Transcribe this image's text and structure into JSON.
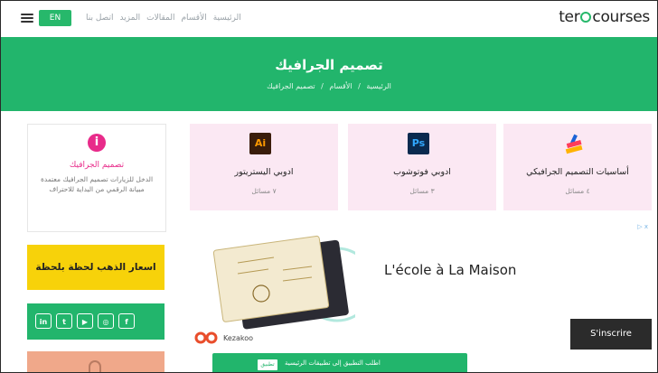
{
  "header": {
    "logo_text_left": "ter",
    "logo_text_right": "courses",
    "lang_button": "EN",
    "nav_items": [
      "الرئيسية",
      "الأقسام",
      "المقالات",
      "المزيد",
      "اتصل بنا"
    ]
  },
  "hero": {
    "title": "تصميم الجرافيك",
    "breadcrumb": [
      "الرئيسية",
      "الأقسام",
      "تصميم الجرافيك"
    ],
    "separator": "/"
  },
  "sidebar": {
    "category_icon": "info-icon",
    "category_icon_glyph": "i",
    "category_title": "تصميم الجرافيك",
    "category_desc": "الدخل للزيارات تصميم الجرافيك معتمدة مبيانة الرقمي من البداية للاحتراف",
    "gold_banner": "اسعار الذهب لحظة بلحظة",
    "social": [
      {
        "name": "linkedin",
        "glyph": "in"
      },
      {
        "name": "twitter",
        "glyph": "t"
      },
      {
        "name": "youtube",
        "glyph": "▶"
      },
      {
        "name": "instagram",
        "glyph": "◎"
      },
      {
        "name": "facebook",
        "glyph": "f"
      }
    ]
  },
  "cards": [
    {
      "title": "أساسيات التصميم الجرافيكي",
      "count": "٤ مسائل",
      "icon": "graphic-design-icon",
      "color": "#ff3c5a"
    },
    {
      "title": "ادوبي فوتوشوب",
      "count": "٣ مسائل",
      "icon_text": "Ps",
      "color": "#0a2a4f"
    },
    {
      "title": "ادوبي اليستريتور",
      "count": "٧ مسائل",
      "icon_text": "Ai",
      "color": "#3a1d0b"
    }
  ],
  "ad": {
    "headline": "L'école à La Maison",
    "brand": "Kezakoo",
    "cta": "S'inscrire",
    "ad_mark": "▷ x"
  },
  "app_banner": {
    "button": "تطبيق",
    "text": "اطلب التطبيق إلى تطبيقات الرئيسية"
  }
}
